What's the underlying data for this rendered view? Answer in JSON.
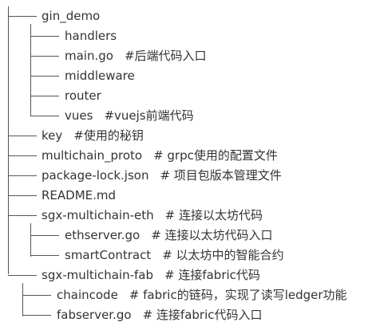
{
  "tree": [
    {
      "name": "gin_demo",
      "comment": ""
    },
    {
      "name": "handlers",
      "comment": ""
    },
    {
      "name": "main.go",
      "comment": "#后端代码入口"
    },
    {
      "name": "middleware",
      "comment": ""
    },
    {
      "name": "router",
      "comment": ""
    },
    {
      "name": "vues",
      "comment": "#vuejs前端代码"
    },
    {
      "name": "key",
      "comment": "#使用的秘钥"
    },
    {
      "name": "multichain_proto",
      "comment": "# grpc使用的配置文件"
    },
    {
      "name": "package-lock.json",
      "comment": "# 项目包版本管理文件"
    },
    {
      "name": "README.md",
      "comment": ""
    },
    {
      "name": "sgx-multichain-eth",
      "comment": "# 连接以太坊代码"
    },
    {
      "name": "ethserver.go",
      "comment": "# 连接以太坊代码入口"
    },
    {
      "name": "smartContract",
      "comment": "# 以太坊中的智能合约"
    },
    {
      "name": "sgx-multichain-fab",
      "comment": "# 连接fabric代码"
    },
    {
      "name": "chaincode",
      "comment": "# fabric的链码，实现了读写ledger功能"
    },
    {
      "name": "fabserver.go",
      "comment": "# 连接fabric代码入口"
    }
  ]
}
